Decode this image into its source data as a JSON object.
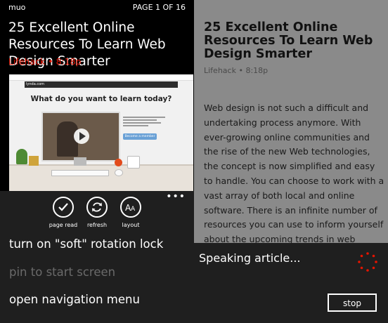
{
  "left": {
    "status": {
      "app_name": "muo",
      "page_indicator": "PAGE 1 OF 16"
    },
    "article": {
      "title": "25 Excellent Online Resources To Learn Web Design Smarter",
      "source": "Lifehack",
      "time": "8:18p",
      "meta_separator": " • "
    },
    "hero_image": {
      "site_logo": "lynda.com",
      "headline": "What do you want to learn today?",
      "cta": "Become a member"
    },
    "app_bar": {
      "buttons": [
        {
          "label": "page read",
          "icon": "check-icon"
        },
        {
          "label": "refresh",
          "icon": "refresh-icon"
        },
        {
          "label": "layout",
          "icon": "font-layout-icon"
        }
      ],
      "more": "•••"
    },
    "menu": [
      {
        "label": "turn on \"soft\" rotation lock",
        "enabled": true
      },
      {
        "label": "pin to start screen",
        "enabled": false
      },
      {
        "label": "open navigation menu",
        "enabled": true
      }
    ],
    "colors": {
      "accent": "#e51400",
      "appbar_bg": "#1f1f1f",
      "disabled_text": "#6a6a6a"
    }
  },
  "right": {
    "article": {
      "title": "25 Excellent Online Resources To Learn Web Design Smarter",
      "source": "Lifehack",
      "time": "8:18p",
      "body": "Web design is not such a difficult and undertaking process anymore. With ever-growing online communities and the rise of the new Web technologies, the concept is now simplified and easy to handle. You can choose to work with a vast array of both local and online software. There is an infinite number of resources you can use to inform yourself about the upcoming trends in web design."
    },
    "speech": {
      "status": "Speaking article...",
      "stop_label": "stop"
    },
    "colors": {
      "page_bg": "#8a8a8a",
      "spinner": "#e51400"
    }
  }
}
